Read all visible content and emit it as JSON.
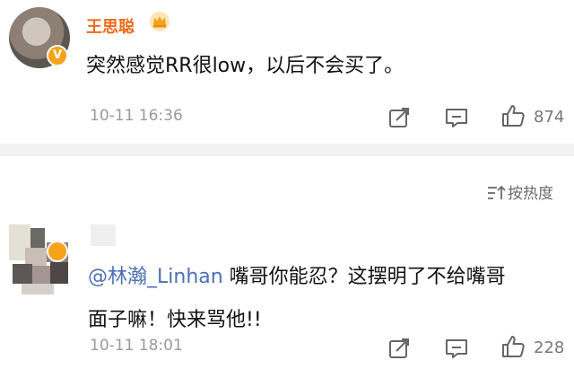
{
  "comment1": {
    "username": "王思聪",
    "text": "突然感觉RR很low，以后不会买了。",
    "time": "10-11 16:36",
    "likes": "874"
  },
  "sort": {
    "label": "按热度"
  },
  "comment2": {
    "mention": "@林瀚_Linhan",
    "text_line1": " 嘴哥你能忍？这摆明了不给嘴哥",
    "text_line2": "面子嘛！快来骂他!!",
    "time": "10-11 18:01",
    "likes": "228"
  },
  "icons": [
    "verified-v-icon",
    "crown-icon",
    "repost-icon",
    "comment-icon",
    "like-icon",
    "sort-icon"
  ],
  "colors": {
    "username": "#f06a1a",
    "mention": "#4a6fb5",
    "badge": "#f7a21b",
    "separator": "#f2f2f2"
  }
}
